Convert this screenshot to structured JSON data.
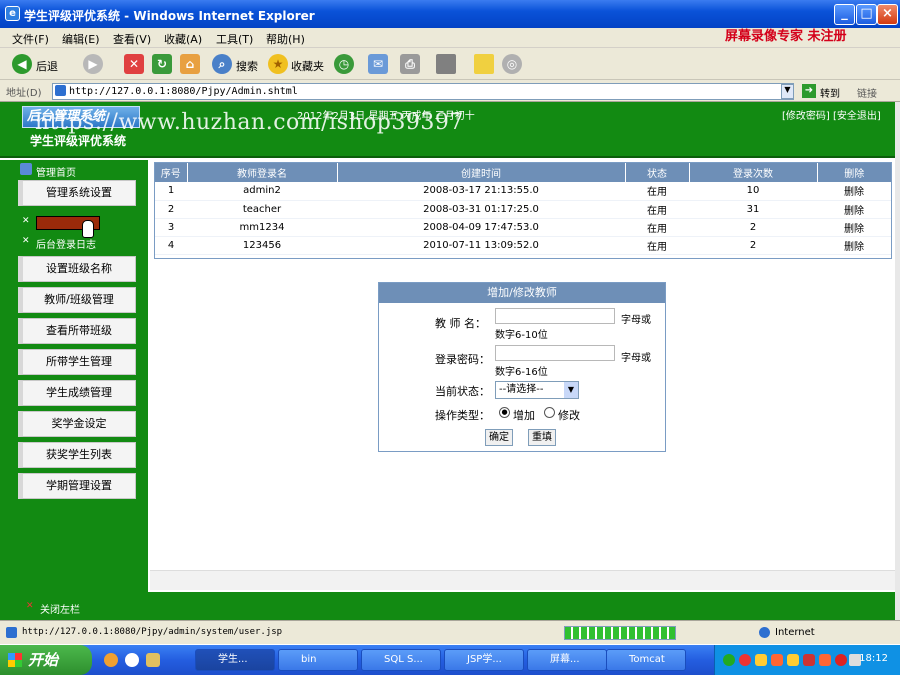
{
  "window": {
    "title": "学生评级评优系统 - Windows Internet Explorer"
  },
  "menubar": {
    "items": [
      "文件(F)",
      "编辑(E)",
      "查看(V)",
      "收藏(A)",
      "工具(T)",
      "帮助(H)"
    ],
    "watermark": "屏幕录像专家 未注册"
  },
  "toolbar": {
    "back": "后退",
    "search": "搜索",
    "favorites": "收藏夹"
  },
  "address": {
    "label": "地址(D)",
    "url": "http://127.0.0.1:8080/Pjpy/Admin.shtml",
    "go": "转到",
    "links": "链接"
  },
  "header": {
    "logo": "后台管理系统",
    "system_name": "学生评级评优系统",
    "date": "2012年2月3日 星期五 丙戌年 三月初十",
    "links": "[修改密码] [安全退出]",
    "watermark_url": "https://www.huzhan.com/ishop39397"
  },
  "sidebar": {
    "home": "管理首页",
    "item_settings": "管理系统设置",
    "login_log": "后台登录日志",
    "items": [
      "设置班级名称",
      "教师/班级管理",
      "查看所带班级",
      "所带学生管理",
      "学生成绩管理",
      "奖学金设定",
      "获奖学生列表",
      "学期管理设置"
    ],
    "close": "关闭左栏"
  },
  "table": {
    "headers": [
      "序号",
      "教师登录名",
      "创建时间",
      "状态",
      "登录次数",
      "删除"
    ],
    "rows": [
      [
        "1",
        "admin2",
        "2008-03-17 21:13:55.0",
        "在用",
        "10",
        "删除"
      ],
      [
        "2",
        "teacher",
        "2008-03-31 01:17:25.0",
        "在用",
        "31",
        "删除"
      ],
      [
        "3",
        "mm1234",
        "2008-04-09 17:47:53.0",
        "在用",
        "2",
        "删除"
      ],
      [
        "4",
        "123456",
        "2010-07-11 13:09:52.0",
        "在用",
        "2",
        "删除"
      ]
    ]
  },
  "form": {
    "title": "增加/修改教师",
    "name_label": "教 师 名：",
    "name_hint_right": "字母或",
    "name_hint_below": "数字6-10位",
    "pwd_label": "登录密码：",
    "pwd_hint_right": "字母或",
    "pwd_hint_below": "数字6-16位",
    "status_label": "当前状态：",
    "status_value": "--请选择--",
    "op_label": "操作类型：",
    "op_add": "增加",
    "op_edit": "修改",
    "ok": "确定",
    "reset": "重填"
  },
  "statusbar": {
    "url": "http://127.0.0.1:8080/Pjpy/admin/system/user.jsp",
    "zone": "Internet"
  },
  "taskbar": {
    "start": "开始",
    "tasks": [
      "学生...",
      "bin",
      "SQL S...",
      "JSP学...",
      "屏幕...",
      "Tomcat"
    ],
    "clock": "18:12"
  }
}
